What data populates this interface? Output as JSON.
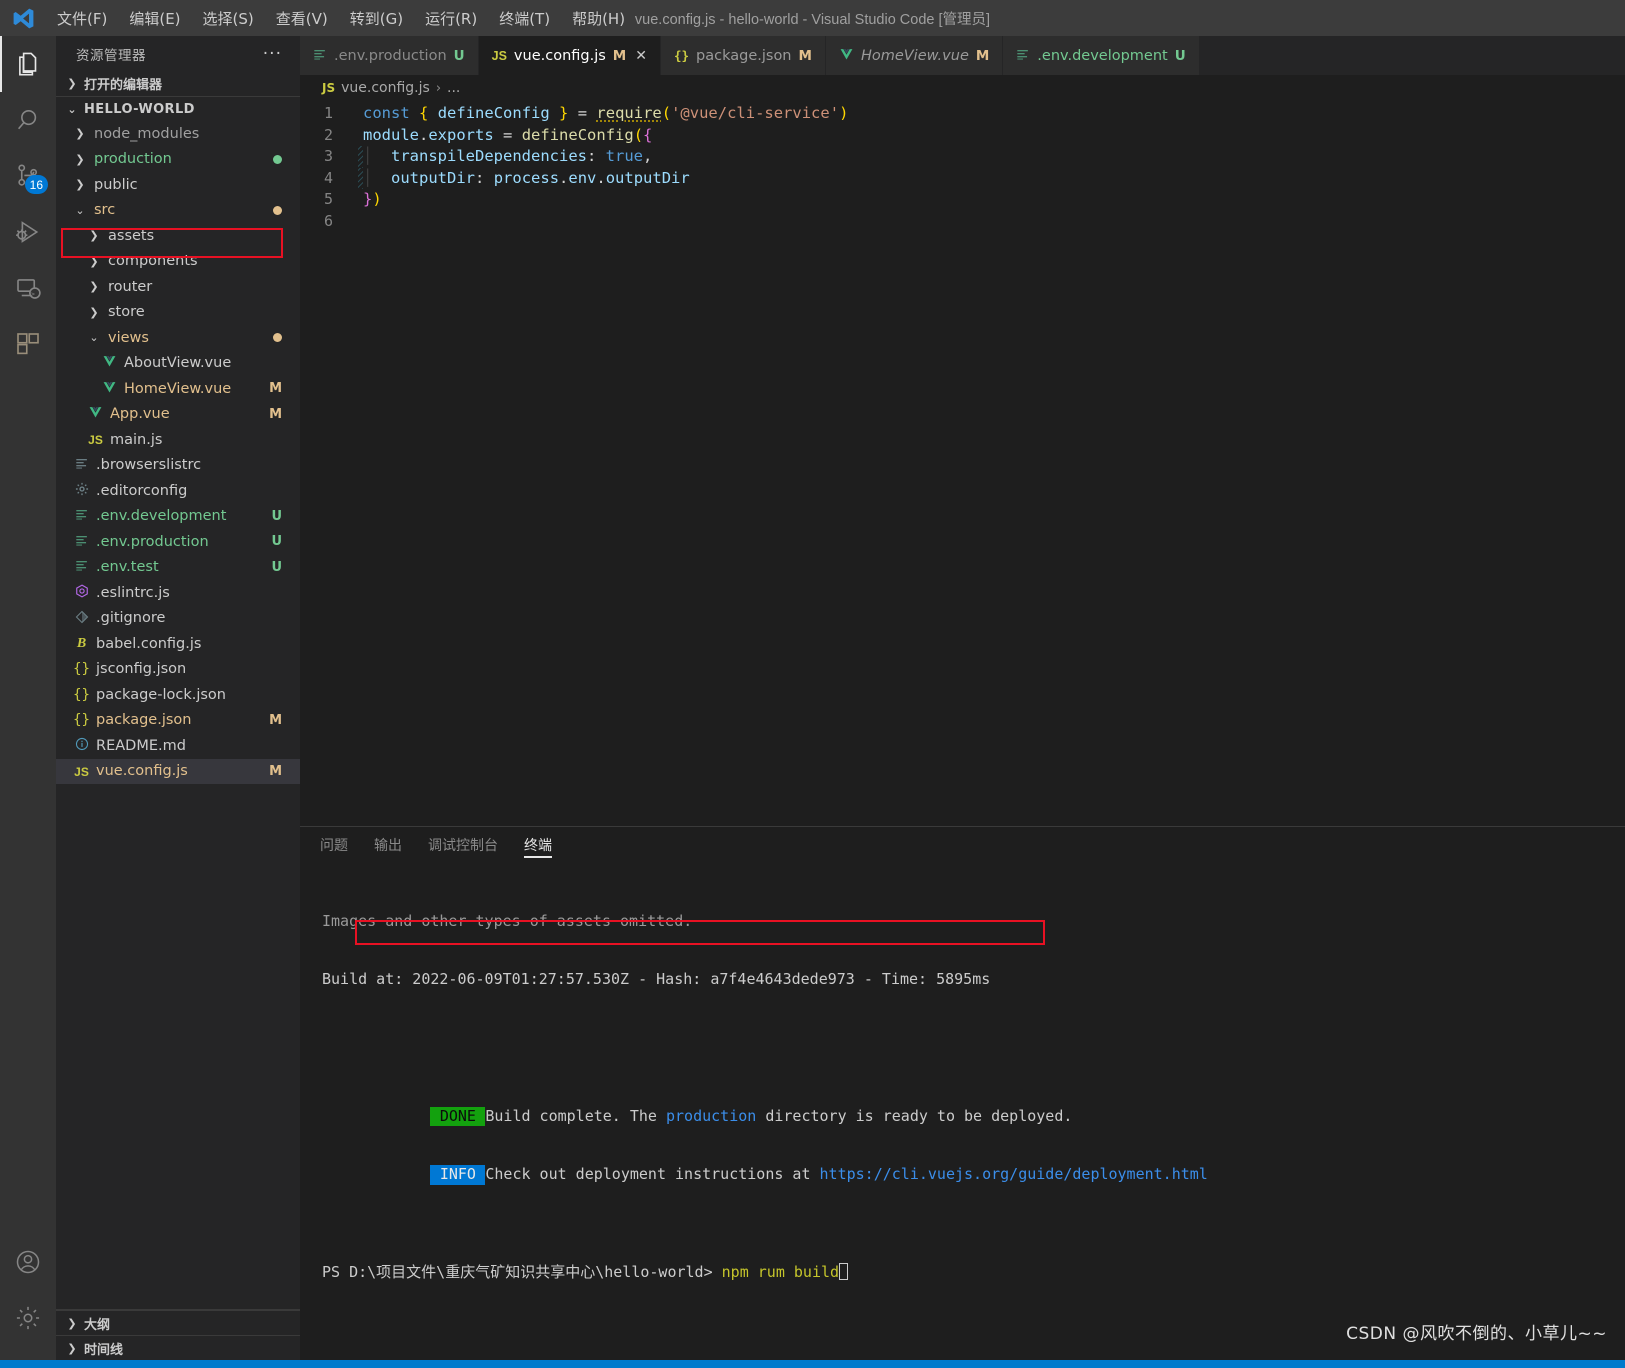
{
  "titlebar": {
    "menus": [
      "文件(F)",
      "编辑(E)",
      "选择(S)",
      "查看(V)",
      "转到(G)",
      "运行(R)",
      "终端(T)",
      "帮助(H)"
    ],
    "title": "vue.config.js - hello-world - Visual Studio Code [管理员]",
    "logo_icon": "vscode-logo-icon"
  },
  "activitybar": {
    "items": [
      {
        "icon": "files-explorer-icon",
        "badge": ""
      },
      {
        "icon": "search-icon",
        "badge": ""
      },
      {
        "icon": "source-control-icon",
        "badge": "16"
      },
      {
        "icon": "run-and-debug-icon",
        "badge": ""
      },
      {
        "icon": "remote-explorer-icon",
        "badge": ""
      },
      {
        "icon": "extensions-icon",
        "badge": ""
      }
    ],
    "bottom": [
      {
        "icon": "account-icon"
      },
      {
        "icon": "manage-gear-icon"
      }
    ]
  },
  "sidebar": {
    "header": "资源管理器",
    "more_actions": "···",
    "open_editors": "打开的编辑器",
    "root": "HELLO-WORLD",
    "tree": [
      {
        "name": "node_modules",
        "type": "folder",
        "chev": "›",
        "indent": 1,
        "color": "#a0a0a0",
        "state": "",
        "dot": ""
      },
      {
        "name": "production",
        "type": "folder",
        "chev": "›",
        "indent": 1,
        "color": "#73c991",
        "state": "",
        "dot": "#73c991"
      },
      {
        "name": "public",
        "type": "folder",
        "chev": "›",
        "indent": 1,
        "color": "#cccccc",
        "state": "",
        "dot": ""
      },
      {
        "name": "src",
        "type": "folder",
        "chev": "⌄",
        "indent": 1,
        "color": "#e2c08d",
        "state": "",
        "dot": "#e2c08d"
      },
      {
        "name": "assets",
        "type": "folder",
        "chev": "›",
        "indent": 2,
        "color": "#cccccc",
        "state": "",
        "dot": ""
      },
      {
        "name": "components",
        "type": "folder",
        "chev": "›",
        "indent": 2,
        "color": "#cccccc",
        "state": "",
        "dot": ""
      },
      {
        "name": "router",
        "type": "folder",
        "chev": "›",
        "indent": 2,
        "color": "#cccccc",
        "state": "",
        "dot": ""
      },
      {
        "name": "store",
        "type": "folder",
        "chev": "›",
        "indent": 2,
        "color": "#cccccc",
        "state": "",
        "dot": ""
      },
      {
        "name": "views",
        "type": "folder",
        "chev": "⌄",
        "indent": 2,
        "color": "#e2c08d",
        "state": "",
        "dot": "#e2c08d"
      },
      {
        "name": "AboutView.vue",
        "type": "file",
        "icon": "vue-icon",
        "icon_color": "#41b883",
        "indent": 3,
        "color": "#cccccc",
        "state": ""
      },
      {
        "name": "HomeView.vue",
        "type": "file",
        "icon": "vue-icon",
        "icon_color": "#41b883",
        "indent": 3,
        "color": "#e2c08d",
        "state": "M"
      },
      {
        "name": "App.vue",
        "type": "file",
        "icon": "vue-icon",
        "icon_color": "#41b883",
        "indent": 2,
        "color": "#e2c08d",
        "state": "M"
      },
      {
        "name": "main.js",
        "type": "file",
        "icon": "js-icon",
        "icon_color": "#cbcb41",
        "indent": 2,
        "color": "#cccccc",
        "state": ""
      },
      {
        "name": ".browserslistrc",
        "type": "file",
        "icon": "config-lines-icon",
        "icon_color": "#6d8086",
        "indent": 1,
        "color": "#cccccc",
        "state": ""
      },
      {
        "name": ".editorconfig",
        "type": "file",
        "icon": "gear-icon",
        "icon_color": "#6d8086",
        "indent": 1,
        "color": "#cccccc",
        "state": ""
      },
      {
        "name": ".env.development",
        "type": "file",
        "icon": "config-lines-icon",
        "icon_color": "#4d9375",
        "indent": 1,
        "color": "#73c991",
        "state": "U"
      },
      {
        "name": ".env.production",
        "type": "file",
        "icon": "config-lines-icon",
        "icon_color": "#4d9375",
        "indent": 1,
        "color": "#73c991",
        "state": "U"
      },
      {
        "name": ".env.test",
        "type": "file",
        "icon": "config-lines-icon",
        "icon_color": "#4d9375",
        "indent": 1,
        "color": "#73c991",
        "state": "U"
      },
      {
        "name": ".eslintrc.js",
        "type": "file",
        "icon": "eslint-icon",
        "icon_color": "#b267e6",
        "indent": 1,
        "color": "#cccccc",
        "state": ""
      },
      {
        "name": ".gitignore",
        "type": "file",
        "icon": "git-icon",
        "icon_color": "#6d8086",
        "indent": 1,
        "color": "#cccccc",
        "state": ""
      },
      {
        "name": "babel.config.js",
        "type": "file",
        "icon": "babel-icon",
        "icon_color": "#cbcb41",
        "indent": 1,
        "color": "#cccccc",
        "state": ""
      },
      {
        "name": "jsconfig.json",
        "type": "file",
        "icon": "json-icon",
        "icon_color": "#cbcb41",
        "indent": 1,
        "color": "#cccccc",
        "state": ""
      },
      {
        "name": "package-lock.json",
        "type": "file",
        "icon": "json-icon",
        "icon_color": "#cbcb41",
        "indent": 1,
        "color": "#cccccc",
        "state": ""
      },
      {
        "name": "package.json",
        "type": "file",
        "icon": "json-icon",
        "icon_color": "#cbcb41",
        "indent": 1,
        "color": "#e2c08d",
        "state": "M"
      },
      {
        "name": "README.md",
        "type": "file",
        "icon": "info-icon",
        "icon_color": "#519aba",
        "indent": 1,
        "color": "#cccccc",
        "state": ""
      },
      {
        "name": "vue.config.js",
        "type": "file",
        "icon": "js-icon",
        "icon_color": "#cbcb41",
        "indent": 1,
        "color": "#e2c08d",
        "state": "M",
        "selected": true
      }
    ],
    "bottom_sections": [
      "大纲",
      "时间线"
    ],
    "highlight_color": "#e81123"
  },
  "tabs": [
    {
      "label": ".env.production",
      "icon": "config-lines-icon",
      "icon_color": "#4d9375",
      "state": "U",
      "state_color": "#73c991",
      "active": false,
      "italic": false,
      "name_color": "#8a8a8a"
    },
    {
      "label": "vue.config.js",
      "icon": "JS",
      "icon_color": "#cbcb41",
      "state": "M",
      "state_color": "#e2c08d",
      "active": true,
      "italic": false,
      "name_color": "#ffffff",
      "close": "✕"
    },
    {
      "label": "package.json",
      "icon": "{}",
      "icon_color": "#cbcb41",
      "state": "M",
      "state_color": "#e2c08d",
      "active": false,
      "italic": false,
      "name_color": "#9a9a9a"
    },
    {
      "label": "HomeView.vue",
      "icon": "vue-icon",
      "icon_color": "#41b883",
      "state": "M",
      "state_color": "#e2c08d",
      "active": false,
      "italic": true,
      "name_color": "#9a9a9a"
    },
    {
      "label": ".env.development",
      "icon": "config-lines-icon",
      "icon_color": "#4d9375",
      "state": "U",
      "state_color": "#73c991",
      "active": false,
      "italic": false,
      "name_color": "#73c991"
    }
  ],
  "breadcrumb": {
    "file": "vue.config.js",
    "sep": "›",
    "rest": "..."
  },
  "editor": {
    "lines": [
      {
        "n": "1",
        "fold": false
      },
      {
        "n": "2",
        "fold": false
      },
      {
        "n": "3",
        "fold": true
      },
      {
        "n": "4",
        "fold": true
      },
      {
        "n": "5",
        "fold": false
      },
      {
        "n": "6",
        "fold": false
      }
    ],
    "code_text": [
      "const { defineConfig } = require('@vue/cli-service')",
      "module.exports = defineConfig({",
      "  transpileDependencies: true,",
      "  outputDir: process.env.outputDir",
      "})",
      ""
    ]
  },
  "panel": {
    "tabs": [
      "问题",
      "输出",
      "调试控制台",
      "终端"
    ],
    "active_tab": "终端",
    "terminal": {
      "line_assets": "Images and other types of assets omitted.",
      "line_build": "Build at: 2022-06-09T01:27:57.530Z - Hash: a7f4e4643dede973 - Time: 5895ms",
      "done_tag": "DONE",
      "done_text_a": "Build complete. The ",
      "done_text_prod": "production",
      "done_text_b": " directory is ready to be deployed.",
      "info_tag": "INFO",
      "info_text": "Check out deployment instructions at ",
      "info_link": "https://cli.vuejs.org/guide/deployment.html",
      "prompt": "PS D:\\项目文件\\重庆气矿知识共享中心\\hello-world> ",
      "command": "npm rum build"
    }
  },
  "watermark": "CSDN @风吹不倒的、小草儿~~",
  "colors": {
    "accent": "#007acc",
    "annotation": "#e81123",
    "modified": "#e2c08d",
    "untracked": "#73c991"
  }
}
